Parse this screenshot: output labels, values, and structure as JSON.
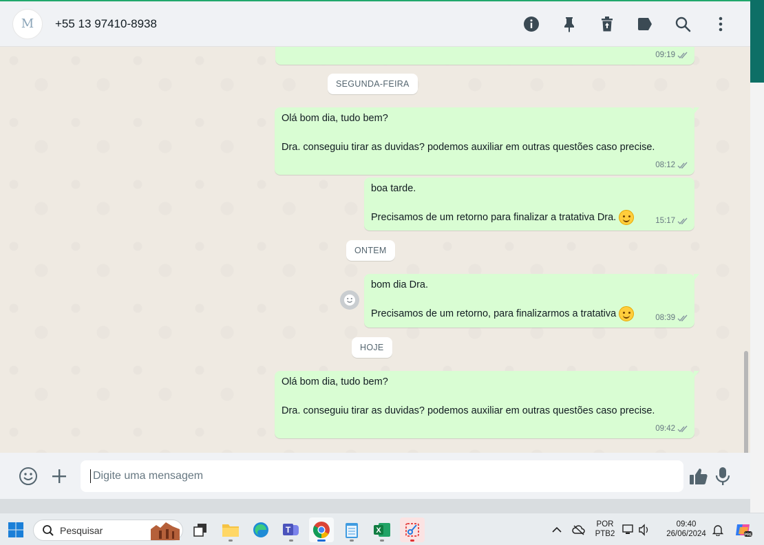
{
  "header": {
    "avatar_letter": "M",
    "contact": "+55 13 97410-8938",
    "icons": [
      "info-icon",
      "pin-icon",
      "trash-icon",
      "label-icon",
      "search-icon",
      "more-icon"
    ]
  },
  "messages": [
    {
      "id": "m0",
      "text": "",
      "time": "09:19"
    },
    {
      "id": "chip1",
      "label": "SEGUNDA-FEIRA"
    },
    {
      "id": "m1",
      "text": "Olá bom dia, tudo bem?\n\nDra. conseguiu tirar as duvidas? podemos auxiliar em outras questões caso precise.",
      "time": "08:12"
    },
    {
      "id": "m2",
      "line1": "boa tarde.",
      "line2": "Precisamos de um retorno para finalizar a tratativa Dra.",
      "time": "15:17"
    },
    {
      "id": "chip2",
      "label": "ONTEM"
    },
    {
      "id": "m3",
      "line1": "bom dia Dra.",
      "line2": "Precisamos de um retorno, para finalizarmos a tratativa",
      "time": "08:39"
    },
    {
      "id": "chip3",
      "label": "HOJE"
    },
    {
      "id": "m4",
      "text": "Olá bom dia, tudo bem?\n\nDra. conseguiu tirar as duvidas? podemos auxiliar em outras questões caso precise.",
      "time": "09:42"
    }
  ],
  "composer": {
    "placeholder": "Digite uma mensagem"
  },
  "taskbar": {
    "search_label": "Pesquisar",
    "lang_top": "POR",
    "lang_bottom": "PTB2",
    "time": "09:40",
    "date": "26/06/2024"
  },
  "colors": {
    "outgoing_bubble": "#d9fdd3",
    "chat_bg": "#efeae2",
    "header_bg": "#f0f2f5",
    "accent": "#21a86c"
  }
}
